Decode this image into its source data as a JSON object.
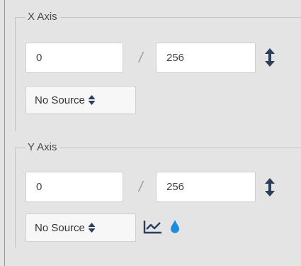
{
  "x_axis": {
    "legend": "X Axis",
    "min_value": "0",
    "separator": "/",
    "max_value": "256",
    "source": "No Source"
  },
  "y_axis": {
    "legend": "Y Axis",
    "min_value": "0",
    "separator": "/",
    "max_value": "256",
    "source": "No Source"
  },
  "colors": {
    "icon_dark": "#2b3e5a",
    "drop_blue": "#1a8ee0"
  }
}
